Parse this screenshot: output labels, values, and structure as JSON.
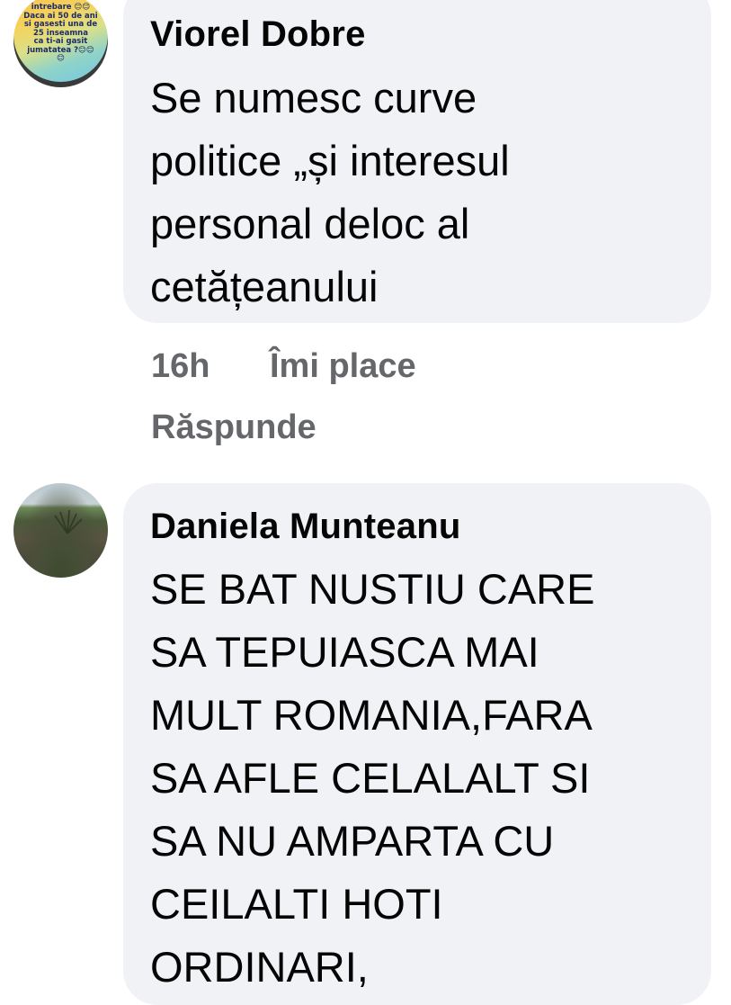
{
  "comments": [
    {
      "author": "Viorel Dobre",
      "text": "Se numesc curve\npolitice „și interesul\npersonal deloc al\ncetățeanului",
      "avatar_text": "intrebare 😊😊\nDaca ai 50 de ani\nsi gasesti una de\n25 inseamna\nca ti-ai gasit\njumatatea ?😊😊\n😊",
      "time": "16h",
      "like_label": "Îmi place",
      "reply_label": "Răspunde"
    },
    {
      "author": "Daniela Munteanu",
      "text": "SE BAT NUSTIU CARE\nSA TEPUIASCA MAI\nMULT ROMANIA,FARA\nSA AFLE CELALALT SI\nSA NU AMPARTA CU\nCEILALTI  HOTI\nORDINARI,"
    }
  ],
  "colors": {
    "bubble_bg": "#f0f2f5",
    "text": "#050505",
    "meta_text": "#65676b"
  }
}
